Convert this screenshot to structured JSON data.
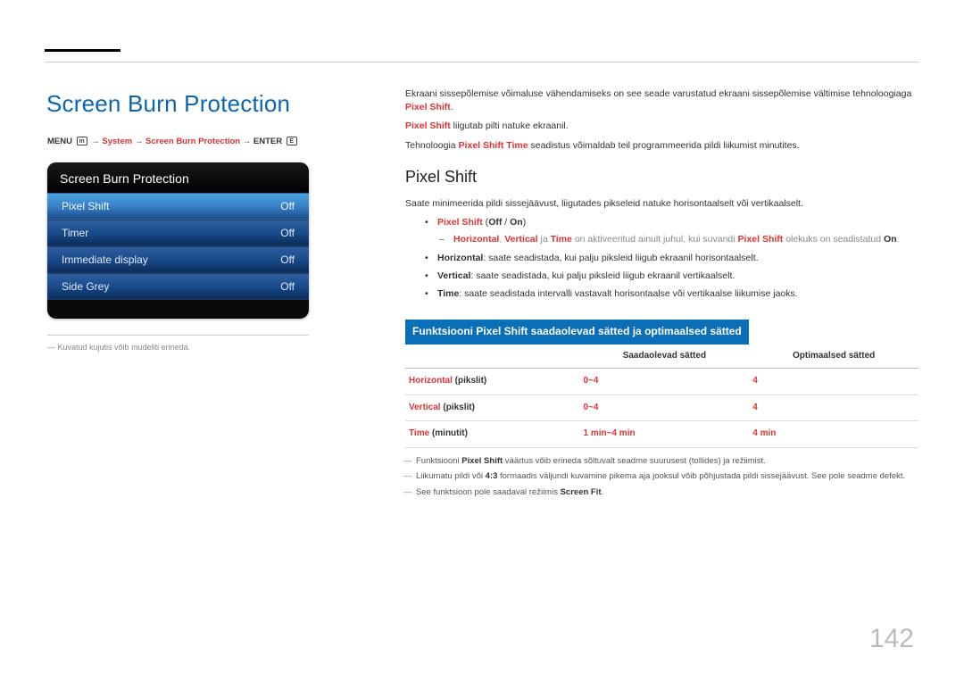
{
  "page_number": "142",
  "title": "Screen Burn Protection",
  "breadcrumb": {
    "menu": "MENU",
    "system": "System",
    "sbp": "Screen Burn Protection",
    "enter": "ENTER",
    "icon_menu": "m",
    "icon_enter": "E"
  },
  "osd": {
    "title": "Screen Burn Protection",
    "rows": [
      {
        "label": "Pixel Shift",
        "value": "Off",
        "hi": true
      },
      {
        "label": "Timer",
        "value": "Off",
        "hi": false
      },
      {
        "label": "Immediate display",
        "value": "Off",
        "hi": false
      },
      {
        "label": "Side Grey",
        "value": "Off",
        "hi": false
      }
    ],
    "note_prefix": "―",
    "note": "Kuvatud kujutis võib mudeliti erineda."
  },
  "intro": {
    "p1_pre": "Ekraani sissepõlemise võimaluse vähendamiseks on see seade varustatud ekraani sissepõlemise vältimise tehnoloogiaga ",
    "p1_red": "Pixel Shift",
    "p1_post": ".",
    "p2_red": "Pixel Shift",
    "p2_post": " liigutab pilti natuke ekraanil.",
    "p3_pre": "Tehnoloogia ",
    "p3_red": "Pixel Shift Time",
    "p3_post": " seadistus võimaldab teil programmeerida pildi liikumist minutites."
  },
  "section": {
    "heading": "Pixel Shift",
    "lead": "Saate minimeerida pildi sissejäävust, liigutades pikseleid natuke horisontaalselt või vertikaalselt.",
    "b1_red": "Pixel Shift",
    "b1_post": " (",
    "b1_off": "Off",
    "b1_sep": " / ",
    "b1_on": "On",
    "b1_close": ")",
    "b1_sub_preA": "",
    "b1_sub_red1": "Horizontal",
    "b1_sub_comma1": ", ",
    "b1_sub_red2": "Vertical",
    "b1_sub_ja": " ja ",
    "b1_sub_red3": "Time",
    "b1_sub_mid": " on aktiveeritud ainult juhul, kui suvandi ",
    "b1_sub_red4": "Pixel Shift",
    "b1_sub_mid2": " olekuks on seadistatud ",
    "b1_sub_on": "On",
    "b1_sub_end": ".",
    "b2_red": "Horizontal",
    "b2_post": ": saate seadistada, kui palju piksleid liigub ekraanil horisontaalselt.",
    "b3_red": "Vertical",
    "b3_post": ": saate seadistada, kui palju piksleid liigub ekraanil vertikaalselt.",
    "b4_red": "Time",
    "b4_post": ": saate seadistada intervalli vastavalt horisontaalse või vertikaalse liikumise jaoks."
  },
  "table": {
    "bar": "Funktsiooni Pixel Shift saadaolevad sätted ja optimaalsed sätted",
    "head": [
      "",
      "Saadaolevad sätted",
      "Optimaalsed sätted"
    ],
    "rows": [
      {
        "label_red": "Horizontal",
        "label_post": " (pikslit)",
        "avail": "0~4",
        "opt": "4"
      },
      {
        "label_red": "Vertical",
        "label_post": " (pikslit)",
        "avail": "0~4",
        "opt": "4"
      },
      {
        "label_red": "Time",
        "label_post": " (minutit)",
        "avail": "1 min~4 min",
        "opt": "4 min"
      }
    ]
  },
  "postnotes": {
    "n1_pre": "Funktsiooni ",
    "n1_red": "Pixel Shift",
    "n1_post": " väärtus võib erineda sõltuvalt seadme suurusest (tollides) ja režiimist.",
    "n2_pre": "Liikumatu pildi või ",
    "n2_bold": "4:3",
    "n2_post": " formaadis väljundi kuvamine pikema aja jooksul võib põhjustada pildi sissejäävust. See pole seadme defekt.",
    "n3_pre": "See funktsioon pole saadaval režiimis ",
    "n3_red": "Screen Fit",
    "n3_post": "."
  }
}
